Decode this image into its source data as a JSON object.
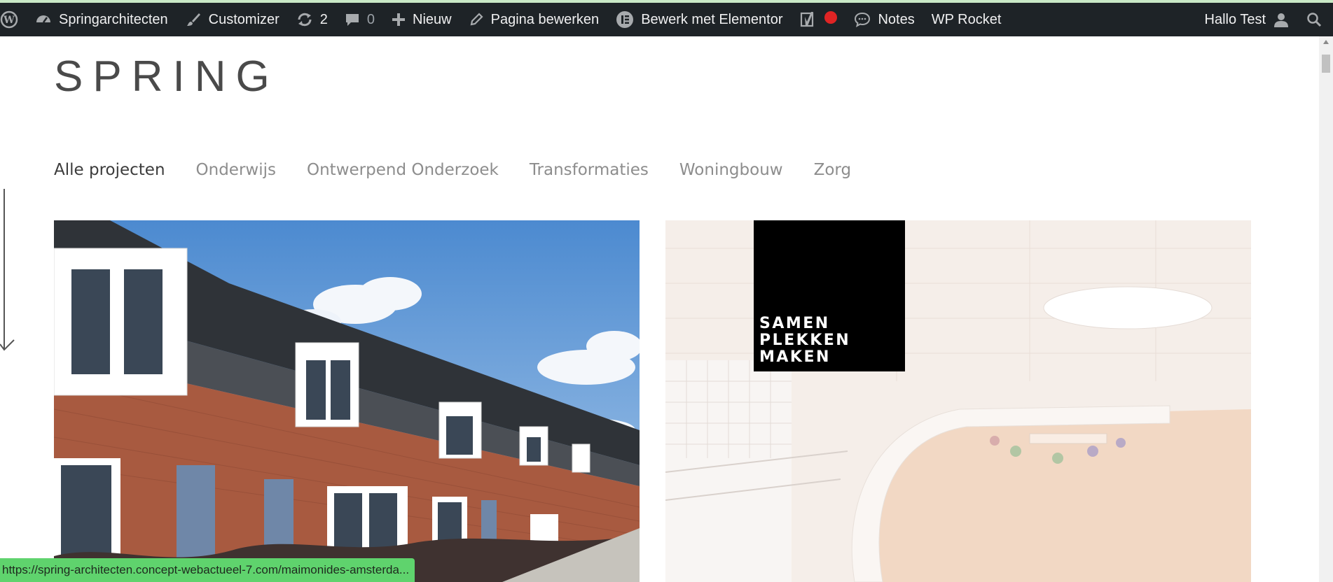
{
  "adminbar": {
    "site_name": "Springarchitecten",
    "customizer": "Customizer",
    "updates_count": "2",
    "comments_count": "0",
    "new": "Nieuw",
    "edit_page": "Pagina bewerken",
    "elementor": "Bewerk met Elementor",
    "notes": "Notes",
    "wp_rocket": "WP Rocket",
    "greeting": "Hallo Test"
  },
  "site": {
    "logo": "SPRING"
  },
  "filters": [
    {
      "label": "Alle projecten",
      "active": true
    },
    {
      "label": "Onderwijs",
      "active": false
    },
    {
      "label": "Ontwerpend Onderzoek",
      "active": false
    },
    {
      "label": "Transformaties",
      "active": false
    },
    {
      "label": "Woningbouw",
      "active": false
    },
    {
      "label": "Zorg",
      "active": false
    }
  ],
  "projects": {
    "badge_lines": [
      "SAMEN",
      "PLEKKEN",
      "MAKEN"
    ]
  },
  "status_url": "https://spring-architecten.concept-webactueel-7.com/maimonides-amsterda...",
  "colors": {
    "adminbar_bg": "#1e2327",
    "status_bg": "#5fd36d",
    "record_dot": "#e02424"
  }
}
